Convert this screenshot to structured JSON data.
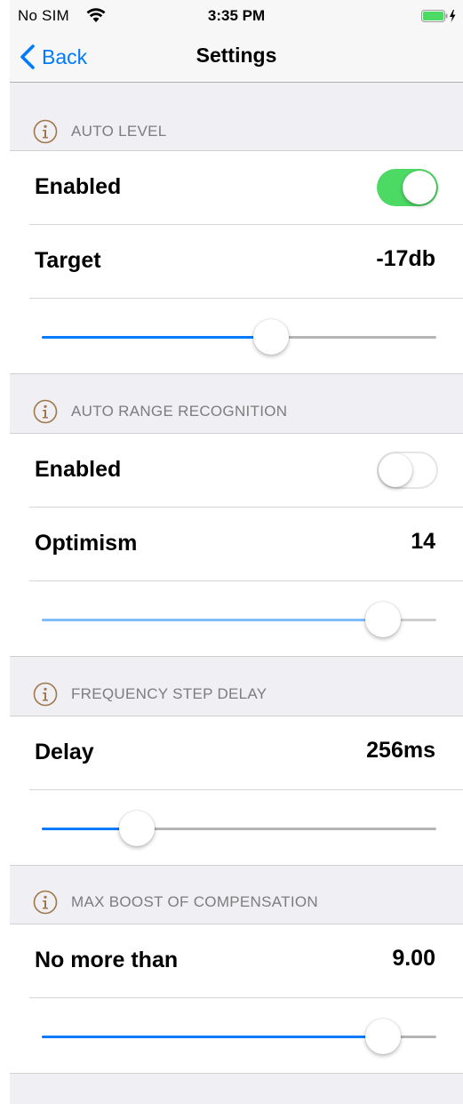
{
  "status_bar": {
    "carrier": "No SIM",
    "time": "3:35 PM",
    "wifi_icon": "wifi-icon",
    "battery_icon": "battery-charging-icon",
    "battery_color": "#4cd964"
  },
  "nav": {
    "back_label": "Back",
    "title": "Settings",
    "accent_color": "#007aff"
  },
  "sections": [
    {
      "title": "AUTO LEVEL",
      "icon": "info-icon",
      "enabled_label": "Enabled",
      "enabled": true,
      "setting_label": "Target",
      "setting_value": "-17db",
      "slider_fraction": 0.58
    },
    {
      "title": "AUTO RANGE RECOGNITION",
      "icon": "info-icon",
      "enabled_label": "Enabled",
      "enabled": false,
      "setting_label": "Optimism",
      "setting_value": "14",
      "slider_fraction": 0.865
    },
    {
      "title": "FREQUENCY STEP DELAY",
      "icon": "info-icon",
      "setting_label": "Delay",
      "setting_value": "256ms",
      "slider_fraction": 0.24
    },
    {
      "title": "MAX BOOST OF COMPENSATION",
      "icon": "info-icon",
      "setting_label": "No more than",
      "setting_value": "9.00",
      "slider_fraction": 0.865
    }
  ],
  "colors": {
    "toggle_on": "#4cd964",
    "slider_fill": "#007aff",
    "slider_fill_disabled": "#7fbcff",
    "info_icon": "#a1774a"
  }
}
